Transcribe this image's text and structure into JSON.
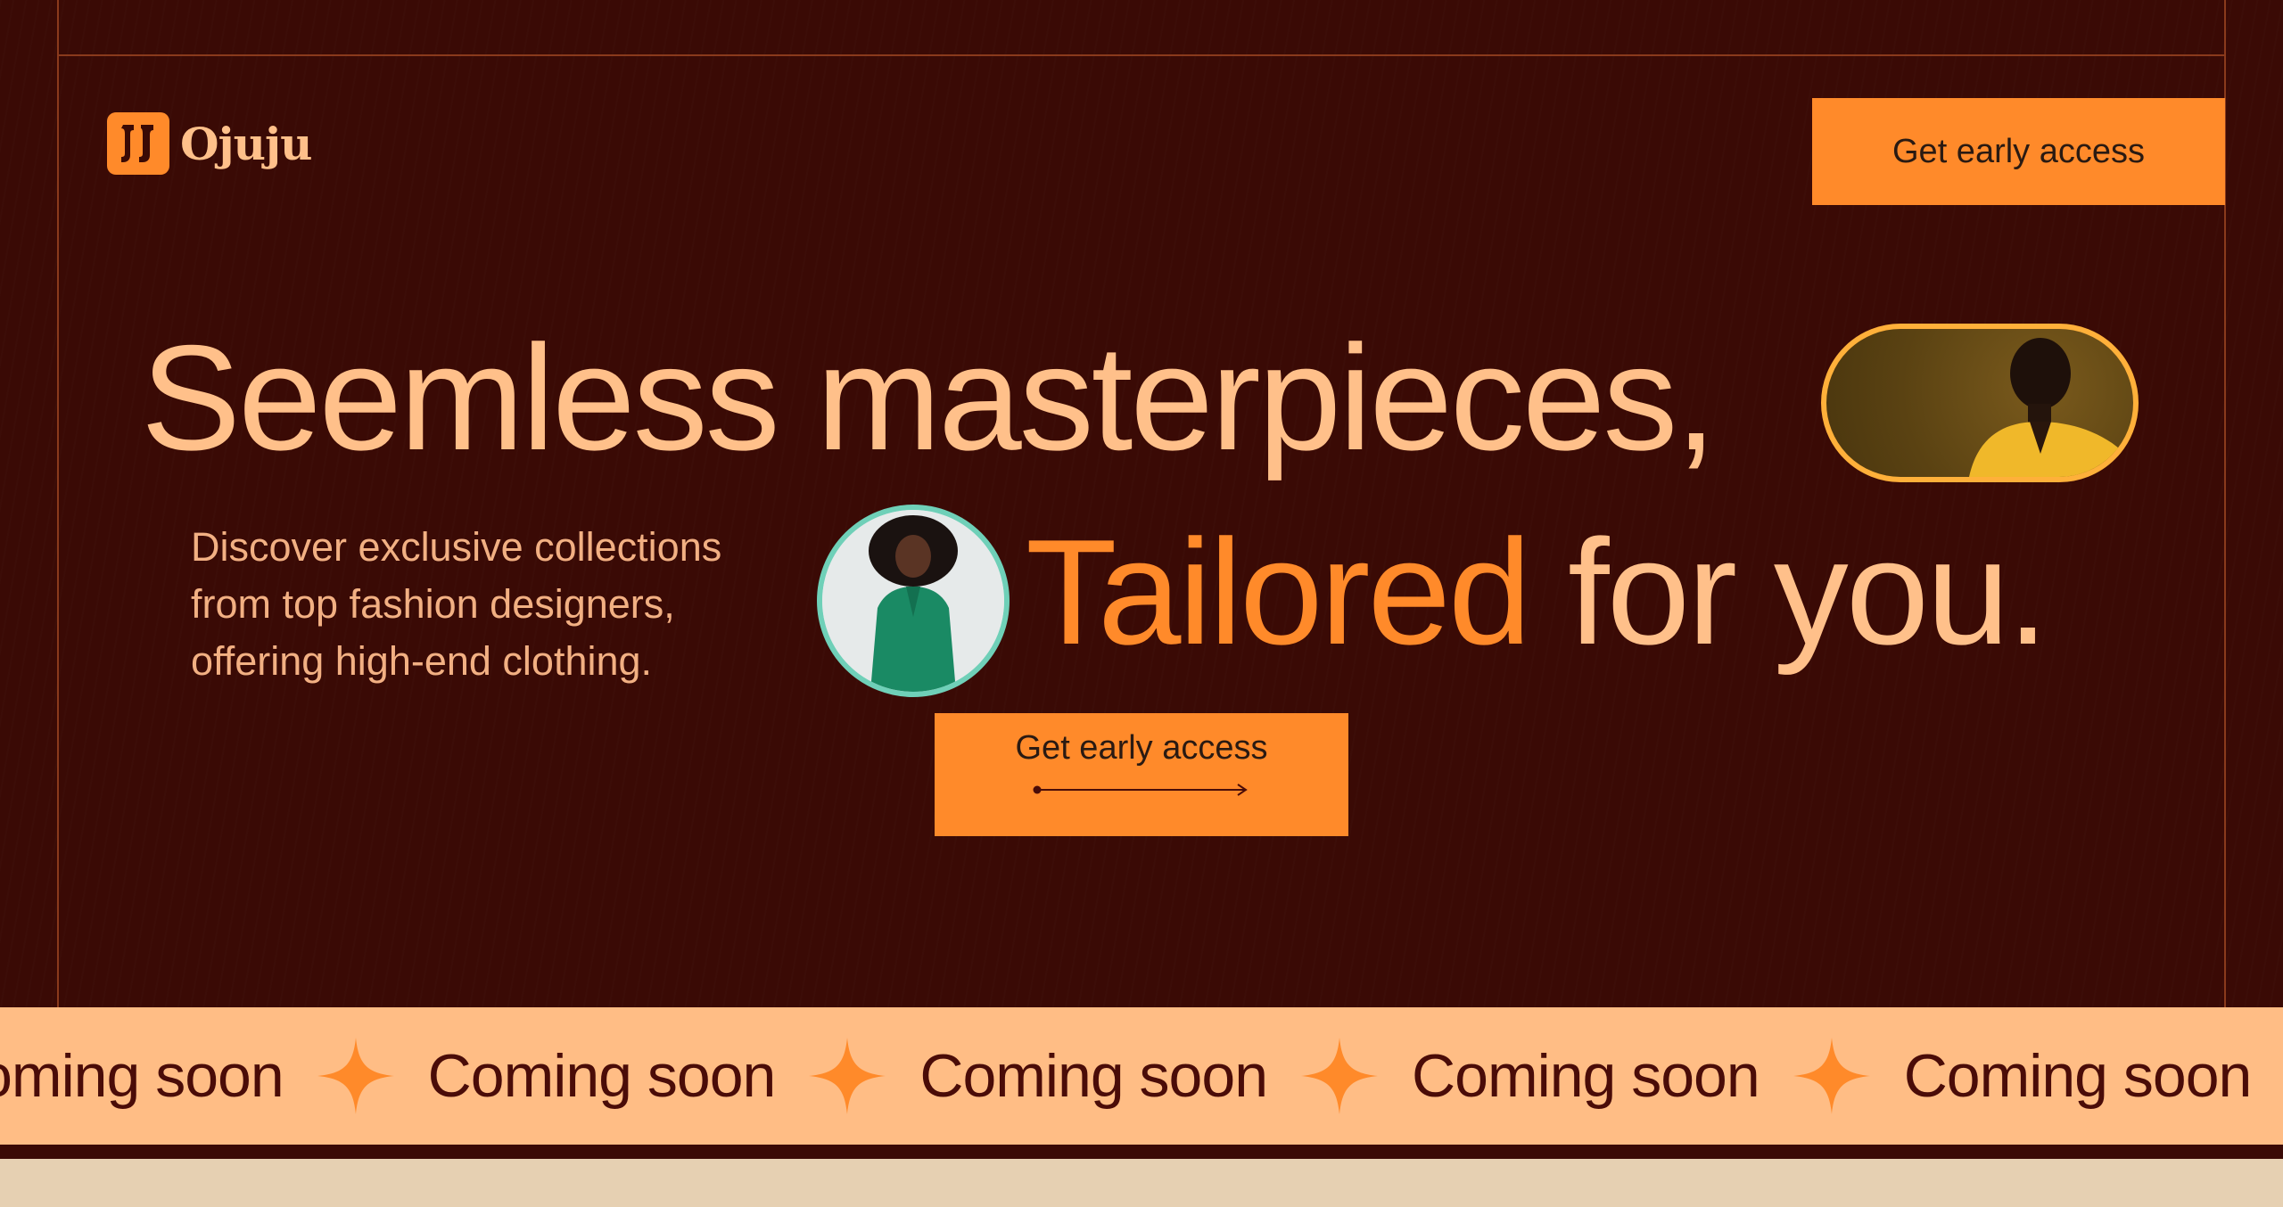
{
  "brand": {
    "name": "Ojuju"
  },
  "nav": {
    "cta_label": "Get early access"
  },
  "hero": {
    "headline_line1": "Seemless masterpieces,",
    "headline_accent": "Tailored",
    "headline_rest": " for you.",
    "description": "Discover exclusive collections from top fashion designers, offering high-end clothing.",
    "cta_label": "Get early access"
  },
  "ticker": {
    "items": [
      "Coming soon",
      "Coming soon",
      "Coming soon",
      "Coming soon",
      "Coming soon"
    ]
  },
  "colors": {
    "background": "#3a0a05",
    "accent": "#ff8a2a",
    "headline": "#ffc08a",
    "ticker_bg": "#ffbd85",
    "pill_border": "#ffb03a",
    "circle_border": "#6fd0b8"
  },
  "icons": {
    "logo_mark": "ojuju-logo-icon",
    "cta_arrow": "arrow-right-icon",
    "ticker_separator": "sparkle-star-icon"
  }
}
